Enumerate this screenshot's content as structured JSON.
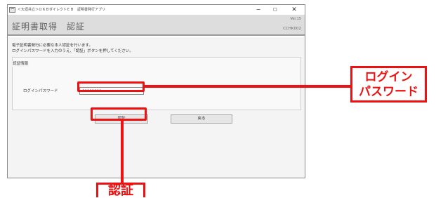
{
  "window": {
    "title": "＜大垣共立＞ＯＫＢダイレクトＥＢ　証明書発行アプリ",
    "controls": {
      "minimize": "−",
      "maximize": "□",
      "close": "✕"
    }
  },
  "header": {
    "title": "証明書取得　認証",
    "version": "Ver.15",
    "screen_code": "CCHK002"
  },
  "instructions": [
    "電子証明書発行に必要な本人認証を行います。",
    "ログインパスワードを入力のうえ、「認証」ボタンを押してください。"
  ],
  "form": {
    "section_label": "認証情報",
    "password_label": "ログインパスワード",
    "password_value": "••••••••"
  },
  "buttons": {
    "auth": "認証",
    "back": "戻る"
  },
  "annotations": {
    "login_password": [
      "ログイン",
      "パスワード"
    ],
    "auth": "認証",
    "color": "#ee1111"
  },
  "icons": {
    "app": "app-window-icon"
  }
}
